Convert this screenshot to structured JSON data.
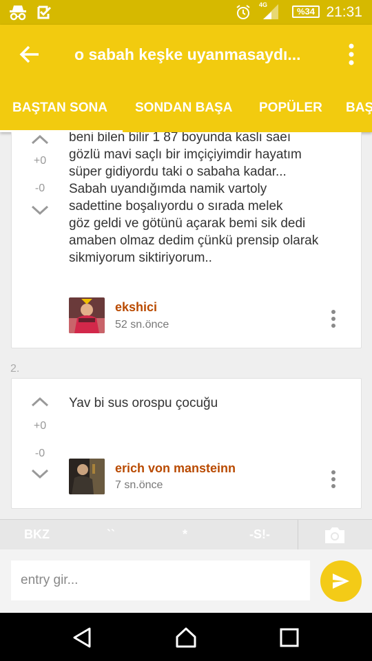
{
  "status_bar": {
    "network": "4G",
    "battery": "%34",
    "time": "21:31",
    "icons": [
      "incognito-icon",
      "checkbox-icon",
      "alarm-icon",
      "signal-icon"
    ]
  },
  "app_bar": {
    "title": "o sabah keşke uyanmasaydı...",
    "colors": {
      "accent": "#f2cb0f",
      "status": "#d6b900",
      "author": "#b94a00"
    }
  },
  "tabs": [
    {
      "label": "BAŞTAN SONA",
      "active": true
    },
    {
      "label": "SONDAN BAŞA",
      "active": false
    },
    {
      "label": "POPÜLER",
      "active": false
    },
    {
      "label": "BAŞ",
      "active": false
    }
  ],
  "entries": [
    {
      "number": "",
      "upvotes": "+0",
      "downvotes": "-0",
      "lines": [
        "beni bilen bilir 1 87 boyunda kaslı saeı",
        "gözlü mavi saçlı bir imçiçiyimdir hayatım",
        "süper gidiyordu taki o sabaha kadar...",
        "Sabah uyandığımda namik vartoly",
        "sadettine boşalıyordu o sırada melek",
        "göz geldi ve götünü açarak bemi sik dedi",
        "amaben olmaz dedim çünkü prensip olarak",
        "sikmiyorum siktiriyorum.."
      ],
      "author": "ekshici",
      "time": "52 sn.önce"
    },
    {
      "number": "2.",
      "upvotes": "+0",
      "downvotes": "-0",
      "lines": [
        "Yav bi sus orospu çocuğu"
      ],
      "author": "erich von mansteinn",
      "time": "7 sn.önce"
    }
  ],
  "toolbar": {
    "bkz": "BKZ",
    "backtick": "``",
    "star": "*",
    "spoiler": "-S!-"
  },
  "composer": {
    "placeholder": "entry gir..."
  }
}
